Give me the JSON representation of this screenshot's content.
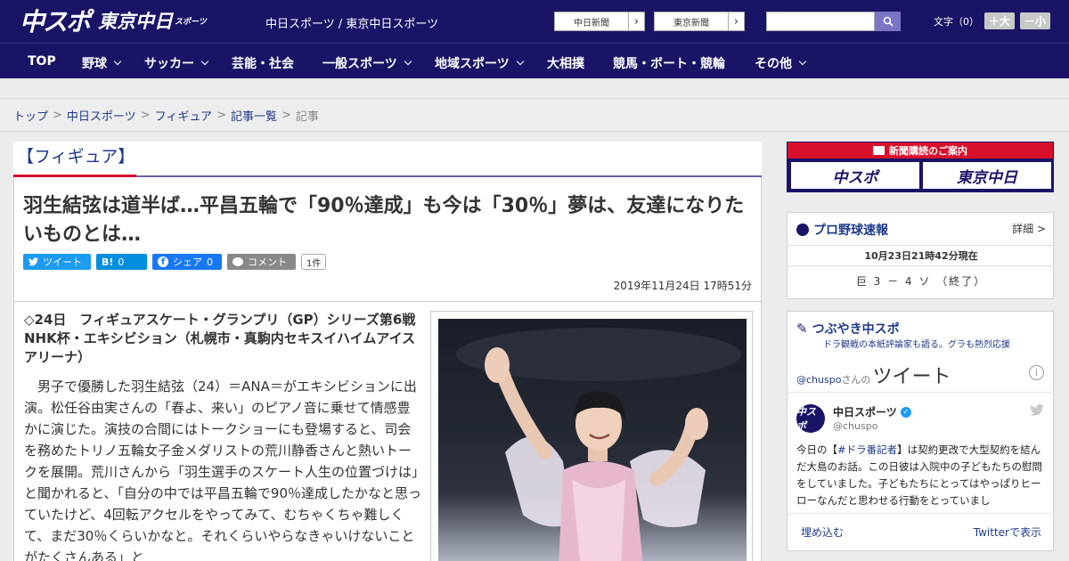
{
  "header": {
    "logo_main": "中スポ",
    "logo_tokyo": "東京中日",
    "logo_tokyo_sub": "スポーツ",
    "tagline": "中日スポーツ / 東京中日スポーツ",
    "btn_chunichi": "中日新聞",
    "btn_tokyo": "東京新聞",
    "font_size_label": "文字（0）",
    "font_bigger": "＋大",
    "font_smaller": "－小"
  },
  "nav": {
    "items": [
      {
        "label": "TOP"
      },
      {
        "label": "野球"
      },
      {
        "label": "サッカー"
      },
      {
        "label": "芸能・社会"
      },
      {
        "label": "一般スポーツ"
      },
      {
        "label": "地域スポーツ"
      },
      {
        "label": "大相撲"
      },
      {
        "label": "競馬・ボート・競輪"
      },
      {
        "label": "その他"
      }
    ]
  },
  "breadcrumb": {
    "items": [
      "トップ",
      "中日スポーツ",
      "フィギュア",
      "記事一覧"
    ],
    "current": "記事"
  },
  "category": "【フィギュア】",
  "article": {
    "title": "羽生結弦は道半ば…平昌五輪で「90％達成」も今は「30％」夢は、友達になりたいものとは…",
    "share": {
      "tweet": "ツイート",
      "hatena": "B!",
      "hatena_count": "0",
      "facebook": "シェア",
      "facebook_count": "0",
      "comment": "コメント",
      "comment_count": "1件"
    },
    "date": "2019年11月24日 17時51分",
    "lead": "◇24日　フィギュアスケート・グランプリ（GP）シリーズ第6戦NHK杯・エキシビション（札幌市・真駒内セキスイハイムアイスアリーナ）",
    "body": "男子で優勝した羽生結弦（24）＝ANA＝がエキシビションに出演。松任谷由実さんの「春よ、来い」のピアノ音に乗せて情感豊かに演じた。演技の合間にはトークショーにも登場すると、司会を務めたトリノ五輪女子金メダリストの荒川静香さんと熱いトークを展開。荒川さんから「羽生選手のスケート人生の位置づけは」と聞かれると、「自分の中では平昌五輪で90％達成したかなと思っていたけど、4回転アクセルをやってみて、むちゃくちゃ難しくて、まだ30％くらいかなと。それくらいやらなきゃいけないことがたくさんある」と"
  },
  "sidebar": {
    "subscribe": {
      "title": "新聞購読のご案内",
      "logo1": "中スポ",
      "logo2": "東京中日"
    },
    "baseball": {
      "title": "プロ野球速報",
      "more": "詳細 >",
      "time": "10月23日21時42分現在",
      "score": "巨 3 － 4 ソ （終了）"
    },
    "tweets": {
      "title": "つぶやき中スポ",
      "subtitle": "ドラ観戦の本紙評論家も語る。グラも熱烈応援",
      "handle_link": "@chuspo",
      "handle_suffix": "さんの",
      "heading": "ツイート",
      "account_name": "中日スポーツ",
      "account_handle": "@chuspo",
      "avatar_text": "中スポ",
      "tweet_before": "今日の【",
      "tweet_hashtag": "#ドラ番記者",
      "tweet_after": "】は契約更改で大型契約を結んだ大島のお話。この日彼は入院中の子どもたちの慰問をしていました。子どもたちにとってはやっぱりヒーローなんだと思わせる行動をとっていまし",
      "embed": "埋め込む",
      "view": "Twitterで表示"
    }
  },
  "colors": {
    "header_bg": "#1a1467",
    "accent_red": "#d8102b",
    "link": "#1e3a8a"
  }
}
